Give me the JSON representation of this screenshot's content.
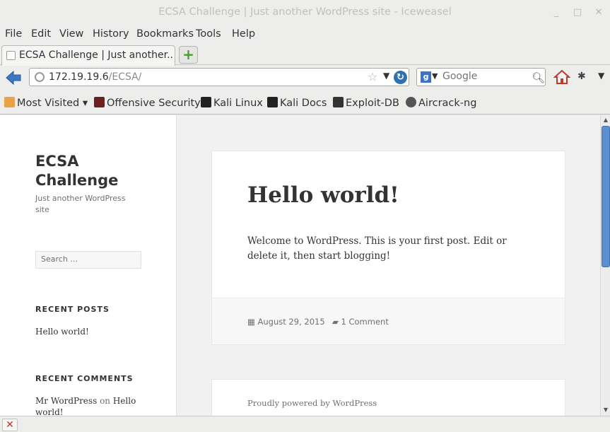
{
  "window": {
    "title": "ECSA Challenge | Just another WordPress site - Iceweasel"
  },
  "menu": {
    "items": [
      "File",
      "Edit",
      "View",
      "History",
      "Bookmarks",
      "Tools",
      "Help"
    ]
  },
  "tab": {
    "label": "ECSA Challenge | Just another..."
  },
  "nav": {
    "url_host": "172.19.19.6",
    "url_path": "/ECSA/",
    "search_placeholder": "Google"
  },
  "bookmarks": {
    "items": [
      "Most Visited",
      "Offensive Security",
      "Kali Linux",
      "Kali Docs",
      "Exploit-DB",
      "Aircrack-ng"
    ]
  },
  "site": {
    "title": "ECSA Challenge",
    "description": "Just another WordPress site",
    "search_placeholder": "Search …",
    "recent_posts_heading": "RECENT POSTS",
    "recent_post_1": "Hello world!",
    "recent_comments_heading": "RECENT COMMENTS",
    "recent_comment_author": "Mr WordPress",
    "recent_comment_on": "on",
    "recent_comment_post": "Hello world!"
  },
  "post": {
    "title": "Hello world!",
    "body": "Welcome to WordPress. This is your first post. Edit or delete it, then start blogging!",
    "date": "August 29, 2015",
    "comments": "1 Comment"
  },
  "footer": {
    "powered_by": "Proudly powered by WordPress"
  }
}
